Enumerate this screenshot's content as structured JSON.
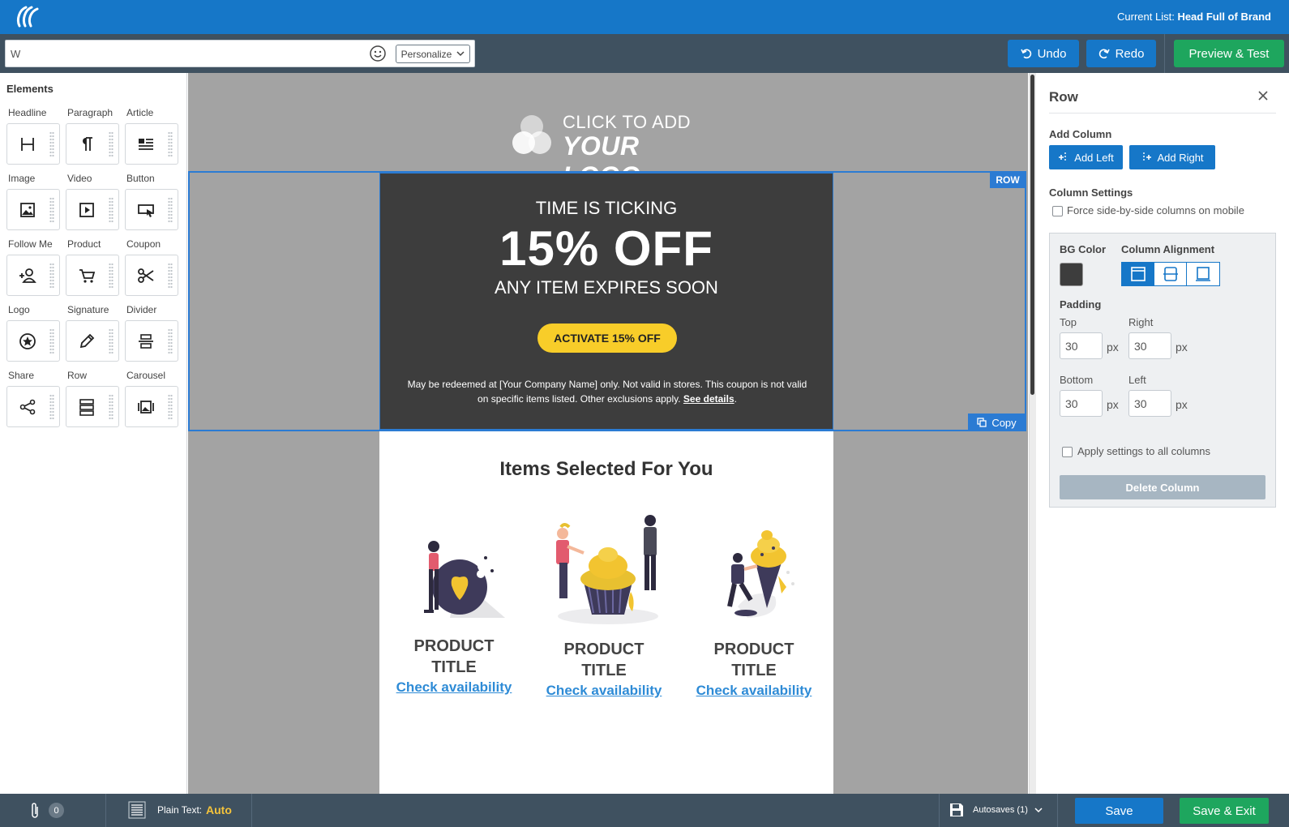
{
  "header": {
    "current_list_label": "Current List:",
    "current_list_value": "Head Full of Brand"
  },
  "toolbar": {
    "subject_value": "W",
    "personalize_label": "Personalize",
    "undo_label": "Undo",
    "redo_label": "Redo",
    "preview_label": "Preview & Test"
  },
  "elements": {
    "title": "Elements",
    "items": [
      {
        "label": "Headline",
        "icon": "headline-icon"
      },
      {
        "label": "Paragraph",
        "icon": "paragraph-icon"
      },
      {
        "label": "Article",
        "icon": "article-icon"
      },
      {
        "label": "Image",
        "icon": "image-icon"
      },
      {
        "label": "Video",
        "icon": "video-icon"
      },
      {
        "label": "Button",
        "icon": "button-icon"
      },
      {
        "label": "Follow Me",
        "icon": "follow-me-icon"
      },
      {
        "label": "Product",
        "icon": "product-cart-icon"
      },
      {
        "label": "Coupon",
        "icon": "coupon-scissors-icon"
      },
      {
        "label": "Logo",
        "icon": "logo-star-icon"
      },
      {
        "label": "Signature",
        "icon": "signature-pen-icon"
      },
      {
        "label": "Divider",
        "icon": "divider-icon"
      },
      {
        "label": "Share",
        "icon": "share-icon"
      },
      {
        "label": "Row",
        "icon": "row-icon"
      },
      {
        "label": "Carousel",
        "icon": "carousel-icon"
      }
    ]
  },
  "canvas": {
    "logo_line1": "CLICK TO ADD",
    "logo_line2": "YOUR LOGO",
    "row_tag": "ROW",
    "copy_label": "Copy",
    "promo": {
      "kicker": "TIME IS TICKING",
      "headline": "15% OFF",
      "subline": "ANY ITEM EXPIRES SOON",
      "cta": "ACTIVATE 15% OFF",
      "fine_print": "May be redeemed at [Your Company Name] only. Not valid in stores. This coupon is not valid on specific items listed. Other exclusions apply.",
      "details_link": "See details",
      "bg_color": "#3d3d3d",
      "cta_color": "#f8cd29"
    },
    "products_title": "Items Selected For You",
    "products": [
      {
        "title": "PRODUCT TITLE",
        "link": "Check availability"
      },
      {
        "title": "PRODUCT TITLE",
        "link": "Check availability"
      },
      {
        "title": "PRODUCT TITLE",
        "link": "Check availability"
      }
    ]
  },
  "row_panel": {
    "title": "Row",
    "add_column_label": "Add Column",
    "add_left": "Add Left",
    "add_right": "Add Right",
    "column_settings_label": "Column Settings",
    "force_side_by_side": "Force side-by-side columns on mobile",
    "force_side_by_side_checked": false,
    "bg_color_label": "BG Color",
    "bg_color_value": "#3d3d3d",
    "column_alignment_label": "Column Alignment",
    "alignment_selected": "top",
    "padding_label": "Padding",
    "padding": {
      "top_label": "Top",
      "top": "30",
      "right_label": "Right",
      "right": "30",
      "bottom_label": "Bottom",
      "bottom": "30",
      "left_label": "Left",
      "left": "30",
      "unit": "px"
    },
    "apply_all_label": "Apply settings to all columns",
    "apply_all_checked": false,
    "delete_column": "Delete Column"
  },
  "bottombar": {
    "attachments_count": "0",
    "plain_text_label": "Plain Text:",
    "plain_text_value": "Auto",
    "autosaves_label": "Autosaves (1)",
    "save_label": "Save",
    "save_exit_label": "Save & Exit"
  },
  "colors": {
    "brand_blue": "#1677c8",
    "action_green": "#1ea65e",
    "toolbar_dark": "#3f5160",
    "selection_blue": "#2b7bd3",
    "link_blue": "#2e8bd6"
  }
}
